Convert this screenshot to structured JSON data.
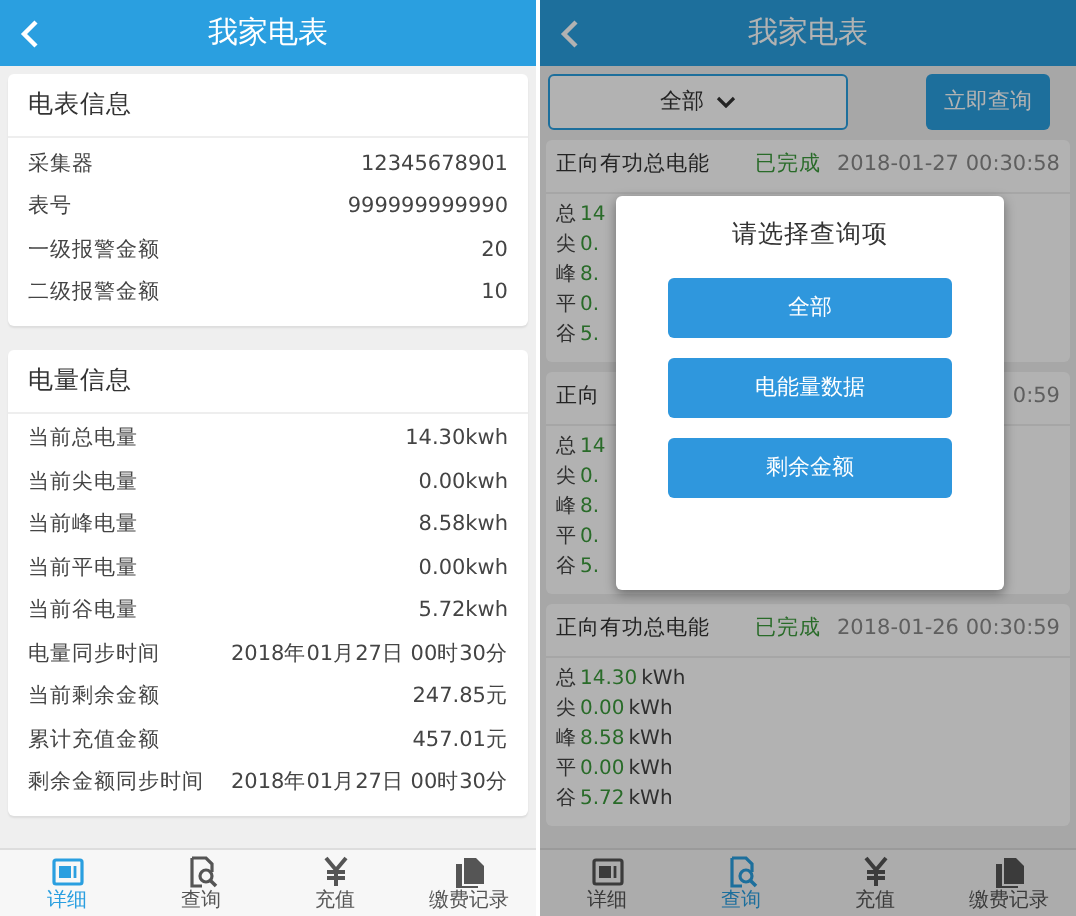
{
  "screens": [
    {
      "kind": "detail",
      "header": {
        "title": "我家电表"
      },
      "sections": [
        {
          "title": "电表信息",
          "rows": [
            {
              "label": "采集器",
              "value": "12345678901"
            },
            {
              "label": "表号",
              "value": "999999999990"
            },
            {
              "label": "一级报警金额",
              "value": "20"
            },
            {
              "label": "二级报警金额",
              "value": "10"
            }
          ]
        },
        {
          "title": "电量信息",
          "rows": [
            {
              "label": "当前总电量",
              "value": "14.30kwh"
            },
            {
              "label": "当前尖电量",
              "value": "0.00kwh"
            },
            {
              "label": "当前峰电量",
              "value": "8.58kwh"
            },
            {
              "label": "当前平电量",
              "value": "0.00kwh"
            },
            {
              "label": "当前谷电量",
              "value": "5.72kwh"
            },
            {
              "label": "电量同步时间",
              "value": "2018年01月27日 00时30分"
            },
            {
              "label": "当前剩余金额",
              "value": "247.85元"
            },
            {
              "label": "累计充值金额",
              "value": "457.01元"
            },
            {
              "label": "剩余金额同步时间",
              "value": "2018年01月27日 00时30分"
            }
          ]
        }
      ],
      "tabs": [
        {
          "label": "详细",
          "selected": true
        },
        {
          "label": "查询",
          "selected": false
        },
        {
          "label": "充值",
          "selected": false
        },
        {
          "label": "缴费记录",
          "selected": false
        }
      ]
    },
    {
      "kind": "query",
      "dimmed": true,
      "header": {
        "title": "我家电表"
      },
      "filter": {
        "value": "全部"
      },
      "query_button": "立即查询",
      "records": [
        {
          "title": "正向有功总电能",
          "status": "已完成",
          "time": "2018-01-27 00:30:58",
          "rows": [
            {
              "label": "总",
              "value": "14"
            },
            {
              "label": "尖",
              "value": "0."
            },
            {
              "label": "峰",
              "value": "8."
            },
            {
              "label": "平",
              "value": "0."
            },
            {
              "label": "谷",
              "value": "5."
            }
          ]
        },
        {
          "title": "正向",
          "time": "0:59",
          "rows": [
            {
              "label": "总",
              "value": "14"
            },
            {
              "label": "尖",
              "value": "0."
            },
            {
              "label": "峰",
              "value": "8."
            },
            {
              "label": "平",
              "value": "0."
            },
            {
              "label": "谷",
              "value": "5."
            }
          ]
        },
        {
          "title": "正向有功总电能",
          "status": "已完成",
          "time": "2018-01-26 00:30:59",
          "rows": [
            {
              "label": "总",
              "value": "14.30",
              "unit": "kWh"
            },
            {
              "label": "尖",
              "value": "0.00",
              "unit": "kWh"
            },
            {
              "label": "峰",
              "value": "8.58",
              "unit": "kWh"
            },
            {
              "label": "平",
              "value": "0.00",
              "unit": "kWh"
            },
            {
              "label": "谷",
              "value": "5.72",
              "unit": "kWh"
            }
          ]
        }
      ],
      "dialog": {
        "title": "请选择查询项",
        "options": [
          "全部",
          "电能量数据",
          "剩余金额"
        ]
      },
      "tabs": [
        {
          "label": "详细",
          "selected": false
        },
        {
          "label": "查询",
          "selected": true
        },
        {
          "label": "充值",
          "selected": false
        },
        {
          "label": "缴费记录",
          "selected": false
        }
      ]
    }
  ]
}
